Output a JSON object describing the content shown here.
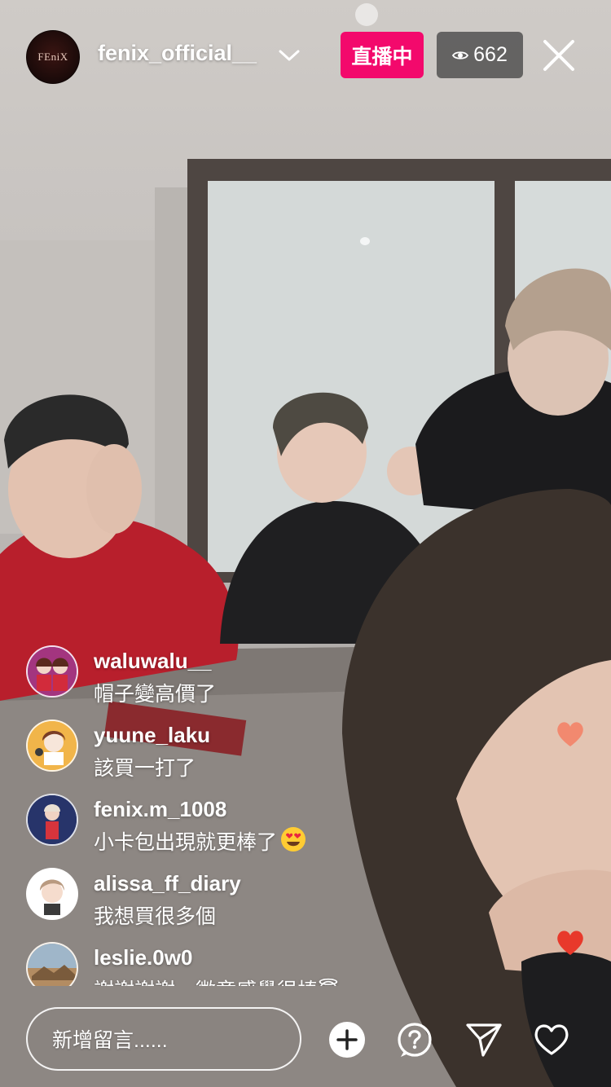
{
  "header": {
    "host_avatar_text": "FEniX",
    "host_name": "fenix_official__",
    "live_label": "直播中",
    "viewer_count": "662"
  },
  "icons": [
    "chevron-down-icon",
    "eye-icon",
    "close-icon",
    "add-circle-icon",
    "question-icon",
    "send-icon",
    "heart-icon"
  ],
  "comments": [
    {
      "user": "waluwalu__",
      "text": "帽子變高價了"
    },
    {
      "user": "yuune_laku",
      "text": "該買一打了"
    },
    {
      "user": "fenix.m_1008",
      "text": "小卡包出現就更棒了",
      "emoji": "heart-eyes"
    },
    {
      "user": "alissa_ff_diary",
      "text": "我想買很多個"
    },
    {
      "user": "leslie.0w0",
      "text": "謝謝謝謝，徽章感覺很棒😇"
    }
  ],
  "footer": {
    "comment_placeholder": "新增留言......"
  },
  "colors": {
    "live_badge": "#f3096c",
    "viewer_badge": "#464646",
    "heart_floating": "#e8392b"
  }
}
